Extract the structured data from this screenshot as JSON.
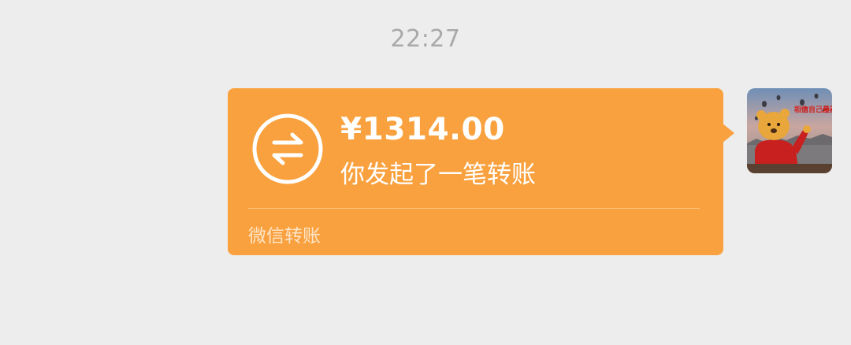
{
  "timestamp": "22:27",
  "transfer": {
    "amount": "¥1314.00",
    "description": "你发起了一笔转账",
    "footer_label": "微信转账",
    "icon": "transfer-arrows-icon"
  },
  "avatar": {
    "icon": "avatar-image",
    "badge_text": "相信自己最棒"
  },
  "colors": {
    "background": "#ededed",
    "bubble": "#f9a13e",
    "timestamp": "#a9a9a9",
    "text_primary": "#ffffff",
    "text_secondary": "#fde5c8"
  }
}
